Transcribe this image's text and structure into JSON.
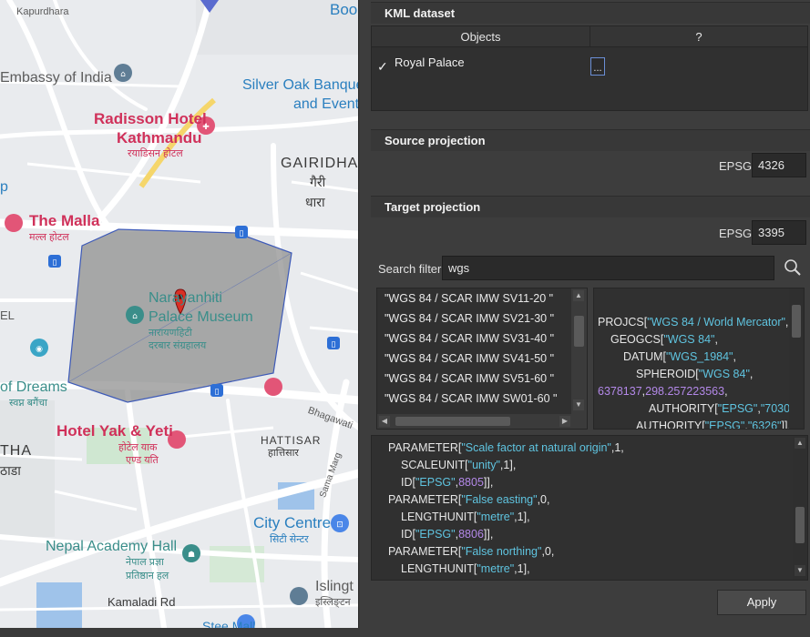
{
  "map": {
    "places": {
      "kapurdhara": "Kapurdhara",
      "boo": "Boo",
      "embassy": "Embassy of India",
      "silver_oak_1": "Silver Oak Banque",
      "silver_oak_2": "and Event",
      "radisson_1": "Radisson Hotel",
      "radisson_2": "Kathmandu",
      "radisson_dev": "रयाडिसन होटल",
      "gairidhara": "GAIRIDHA",
      "gairidhara_dev_1": "गैरी",
      "gairidhara_dev_2": "धारा",
      "p_partial": "p",
      "the_malla": "The Malla",
      "the_malla_dev": "मल्ल होटल",
      "museum_1": "Narayanhiti",
      "museum_2": "Palace Museum",
      "museum_dev_1": "नारायणहिटी",
      "museum_dev_2": "दरबार संग्रहालय",
      "el_partial": "EL",
      "dreams_1": "of Dreams",
      "dreams_dev": "स्वप्न बगैंचा",
      "bhagawati": "Bhagawati",
      "hotel_yak": "Hotel Yak & Yeti",
      "hotel_yak_dev_1": "होटेल याक",
      "hotel_yak_dev_2": "एण्ड यति",
      "tha": "THA",
      "tha_dev": "ठाडा",
      "hattisar": "HATTISAR",
      "hattisar_dev": "हात्तिसार",
      "sama_marg": "Sama Marg",
      "city_centre_1": "City Centre",
      "city_centre_dev": "सिटी सेन्टर",
      "nepal_academy_1": "Nepal Academy Hall",
      "nepal_academy_dev_1": "नेपाल प्रज्ञा",
      "nepal_academy_dev_2": "प्रतिष्ठान हल",
      "islingt": "Islingt",
      "islingt_dev": "इस्लिङ्टन",
      "kamaladi": "Kamaladi Rd",
      "stee_partial": "Stee Mall"
    }
  },
  "kml": {
    "section_title": "KML dataset",
    "columns": [
      "Objects",
      "?"
    ],
    "rows": [
      {
        "check": "✓",
        "name": "Royal Palace",
        "action": "..."
      }
    ]
  },
  "source": {
    "section_title": "Source projection",
    "epsg_label": "EPSG:",
    "epsg_value": "4326"
  },
  "target": {
    "section_title": "Target projection",
    "epsg_label": "EPSG:",
    "epsg_value": "3395",
    "search_label": "Search filter:",
    "search_value": "wgs",
    "list": [
      "\"WGS 84 / SCAR IMW SV11-20 \"",
      "\"WGS 84 / SCAR IMW SV21-30 \"",
      "\"WGS 84 / SCAR IMW SV31-40 \"",
      "\"WGS 84 / SCAR IMW SV41-50 \"",
      "\"WGS 84 / SCAR IMW SV51-60 \"",
      "\"WGS 84 / SCAR IMW SW01-60 \""
    ]
  },
  "wkt_short": {
    "l1a": "PROJCS[",
    "l1b": "\"WGS 84 / World Mercator\"",
    "l1c": ",",
    "l2a": "GEOGCS[",
    "l2b": "\"WGS 84\"",
    "l2c": ",",
    "l3a": "DATUM[",
    "l3b": "\"WGS_1984\"",
    "l3c": ",",
    "l4a": "SPHEROID[",
    "l4b": "\"WGS 84\"",
    "l4c": ",",
    "l5a": "6378137",
    "l5b": ",",
    "l5c": "298.257223563",
    "l5d": ",",
    "l6a": "AUTHORITY[",
    "l6b": "\"EPSG\"",
    "l6c": ",",
    "l6d": "\"7030\"",
    "l6e": "]],",
    "l7a": "AUTHORITY[",
    "l7b": "\"EPSG\"",
    "l7c": ",",
    "l7d": "\"6326\"",
    "l7e": "]],"
  },
  "wkt_long": {
    "l1a": "PARAMETER[",
    "l1b": "\"Scale factor at natural origin\"",
    "l1c": ",1,",
    "l2a": "SCALEUNIT[",
    "l2b": "\"unity\"",
    "l2c": ",1],",
    "l3a": "ID[",
    "l3b": "\"EPSG\"",
    "l3c": ",",
    "l3d": "8805",
    "l3e": "]],",
    "l4a": "PARAMETER[",
    "l4b": "\"False easting\"",
    "l4c": ",0,",
    "l5a": "LENGTHUNIT[",
    "l5b": "\"metre\"",
    "l5c": ",1],",
    "l6a": "ID[",
    "l6b": "\"EPSG\"",
    "l6c": ",",
    "l6d": "8806",
    "l6e": "]],",
    "l7a": "PARAMETER[",
    "l7b": "\"False northing\"",
    "l7c": ",0,",
    "l8a": "LENGTHUNIT[",
    "l8b": "\"metre\"",
    "l8c": ",1],"
  },
  "apply_label": "Apply",
  "colors": {
    "panel_bg": "#3d3d3d",
    "string": "#5fc4e0",
    "number": "#b388e8",
    "polygon_fill": "#8c8c8c",
    "marker": "#d93025"
  }
}
